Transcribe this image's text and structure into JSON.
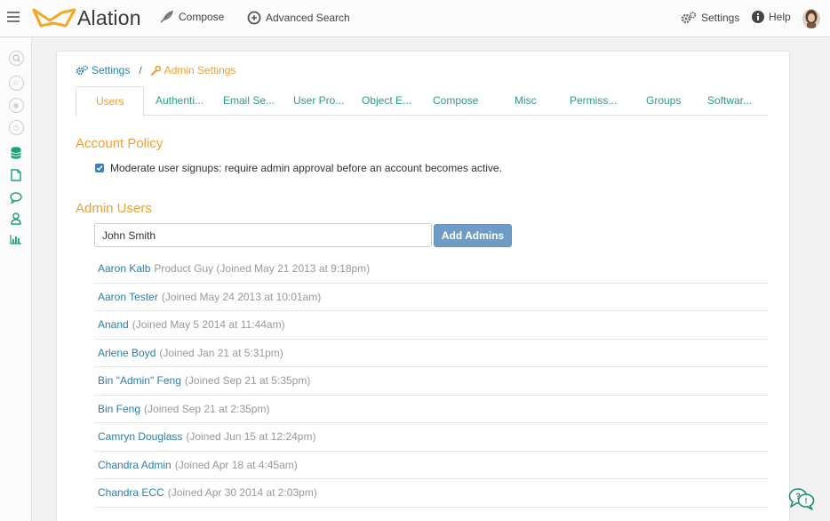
{
  "topbar": {
    "brand": "Alation",
    "compose_label": "Compose",
    "advanced_search_label": "Advanced Search",
    "settings_label": "Settings",
    "help_label": "Help"
  },
  "breadcrumb": {
    "settings": "Settings",
    "separator": "/",
    "admin_settings": "Admin Settings"
  },
  "tabs": [
    {
      "label": "Users",
      "active": true
    },
    {
      "label": "Authenti..."
    },
    {
      "label": "Email Se..."
    },
    {
      "label": "User Pro..."
    },
    {
      "label": "Object E..."
    },
    {
      "label": "Compose"
    },
    {
      "label": "Misc"
    },
    {
      "label": "Permiss..."
    },
    {
      "label": "Groups"
    },
    {
      "label": "Softwar..."
    }
  ],
  "account_policy": {
    "title": "Account Policy",
    "checkbox_label": "Moderate user signups: require admin approval before an account becomes active.",
    "checked": true
  },
  "admin_users": {
    "title": "Admin Users",
    "input_value": "John Smith",
    "add_button": "Add Admins",
    "users": [
      {
        "name": "Aaron Kalb",
        "meta": "Product Guy (Joined May 21 2013 at 9:18pm)"
      },
      {
        "name": "Aaron Tester",
        "meta": "(Joined May 24 2013 at 10:01am)"
      },
      {
        "name": "Anand",
        "meta": "(Joined May 5 2014 at 11:44am)"
      },
      {
        "name": "Arlene Boyd",
        "meta": "(Joined Jan 21 at 5:31pm)"
      },
      {
        "name": "Bin \"Admin\" Feng",
        "meta": "(Joined Sep 21 at 5:35pm)"
      },
      {
        "name": "Bin Feng",
        "meta": "(Joined Sep 21 at 2:35pm)"
      },
      {
        "name": "Camryn Douglass",
        "meta": "(Joined Jun 15 at 12:24pm)"
      },
      {
        "name": "Chandra Admin",
        "meta": "(Joined Apr 18 at 4:45am)"
      },
      {
        "name": "Chandra ECC",
        "meta": "(Joined Apr 30 2014 at 2:03pm)"
      }
    ]
  },
  "colors": {
    "accent_orange": "#f0a030",
    "link_blue": "#2c7da8",
    "tab_teal": "#2a9a8e",
    "rail_green": "#1aa37a",
    "button_blue": "#6e9cc4"
  }
}
